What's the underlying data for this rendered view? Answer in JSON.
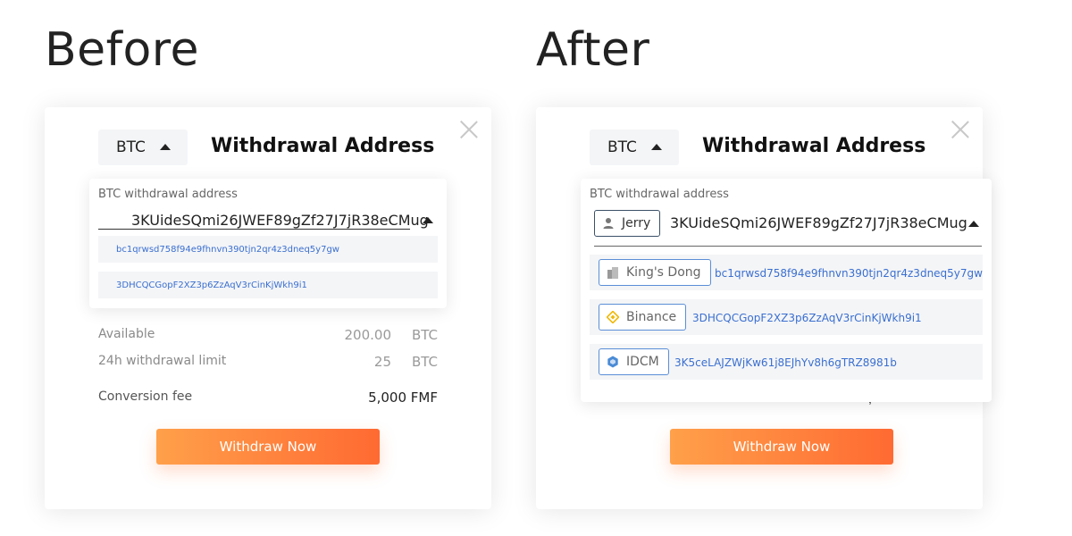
{
  "headings": {
    "before": "Before",
    "after": "After"
  },
  "before": {
    "coin": "BTC",
    "title": "Withdrawal Address",
    "address_label": "BTC withdrawal address",
    "address_value": "3KUideSQmi26JWEF89gZf27J7jR38eCMug",
    "options": [
      "bc1qrwsd758f94e9fhnvn390tjn2qr4z3dneq5y7gw",
      "3DHCQCGopF2XZ3p6ZzAqV3rCinKjWkh9i1"
    ],
    "rows": {
      "available_label": "Available",
      "available_value": "200.00",
      "available_unit": "BTC",
      "limit_label": "24h withdrawal limit",
      "limit_value": "25",
      "limit_unit": "BTC",
      "fee_label": "Conversion fee",
      "fee_value": "5,000 FMF"
    },
    "button": "Withdraw Now"
  },
  "after": {
    "coin": "BTC",
    "title": "Withdrawal Address",
    "address_label": "BTC withdrawal address",
    "selected_tag": "Jerry",
    "address_value": "3KUideSQmi26JWEF89gZf27J7jR38eCMug",
    "options": [
      {
        "tag": "King's Dong",
        "icon": "building-icon",
        "address": "bc1qrwsd758f94e9fhnvn390tjn2qr4z3dneq5y7gw"
      },
      {
        "tag": "Binance",
        "icon": "binance-icon",
        "address": "3DHCQCGopF2XZ3p6ZzAqV3rCinKjWkh9i1"
      },
      {
        "tag": "IDCM",
        "icon": "idcm-icon",
        "address": "3K5ceLAJZWjKw61j8EJhYv8h6gTRZ8981b"
      }
    ],
    "button": "Withdraw Now"
  },
  "colors": {
    "accent_start": "#ffa04a",
    "accent_end": "#ff6a32",
    "link_blue": "#3a6fd0",
    "binance_yellow": "#f0b90b",
    "idcm_blue": "#4a8bd6"
  }
}
